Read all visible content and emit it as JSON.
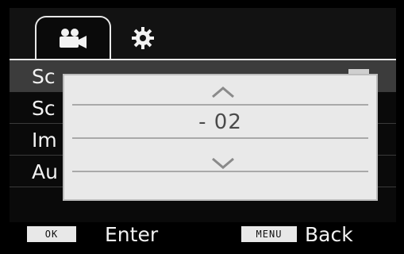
{
  "tabs": [
    {
      "icon": "video-camera-icon",
      "active": true
    },
    {
      "icon": "gear-icon",
      "active": false
    }
  ],
  "menu": {
    "items": [
      {
        "label": "Sc",
        "selected": true
      },
      {
        "label": "Sc",
        "selected": false
      },
      {
        "label": "Im",
        "selected": false
      },
      {
        "label": "Au",
        "selected": false
      }
    ]
  },
  "dialog": {
    "value": "- 02",
    "up_icon": "chevron-up-icon",
    "down_icon": "chevron-down-icon"
  },
  "hints": {
    "ok_key": "OK",
    "ok_label": "Enter",
    "menu_key": "MENU",
    "menu_label": "Back"
  },
  "colors": {
    "background": "#0a0a0a",
    "highlight": "#3c3c3c",
    "dialog": "#e9e9e9",
    "text": "#f2f2f2"
  }
}
